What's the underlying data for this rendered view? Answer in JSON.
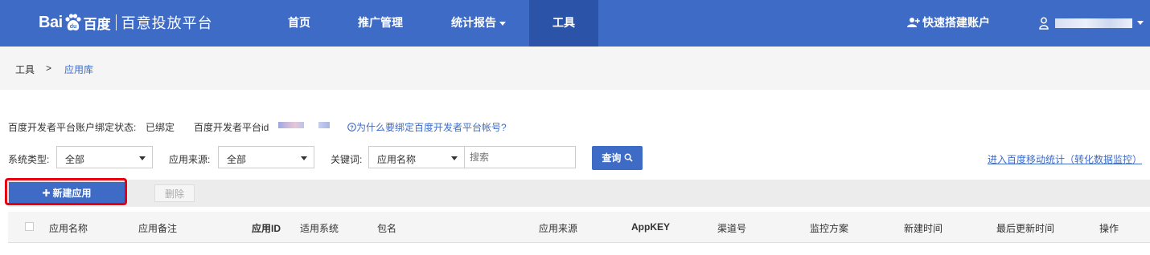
{
  "topbar": {
    "logo_main": "Bai",
    "logo_baidu": "百度",
    "logo_sub": "百意投放平台",
    "nav": [
      "首页",
      "推广管理",
      "统计报告",
      "工具"
    ],
    "quick_create": "快速搭建账户"
  },
  "breadcrumb": {
    "root": "工具",
    "sep": ">",
    "current": "应用库"
  },
  "dev_binding": {
    "status_label": "百度开发者平台账户绑定状态:",
    "status_value": "已绑定",
    "id_label": "百度开发者平台id",
    "help_link": "为什么要绑定百度开发者平台帐号?"
  },
  "filters": {
    "system_label": "系统类型:",
    "system_value": "全部",
    "source_label": "应用来源:",
    "source_value": "全部",
    "keyword_label": "关键词:",
    "keyword_field": "应用名称",
    "search_placeholder": "搜索",
    "query_button": "查询",
    "stat_link": "进入百度移动统计（转化数据监控）"
  },
  "toolbar": {
    "new_button": "新建应用",
    "delete_button": "删除"
  },
  "table": {
    "columns": [
      "应用名称",
      "应用备注",
      "应用ID",
      "适用系统",
      "包名",
      "应用来源",
      "AppKEY",
      "渠道号",
      "监控方案",
      "新建时间",
      "最后更新时间",
      "操作"
    ]
  },
  "colors": {
    "brand": "#3e6bc6",
    "nav_active": "#2b54a8",
    "highlight": "#e60012"
  }
}
